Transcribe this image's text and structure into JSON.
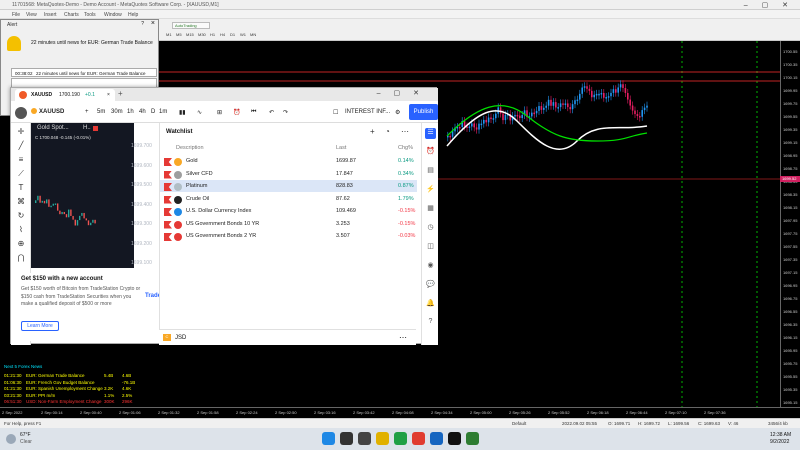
{
  "app": {
    "title": "11701568: MetaQuotes-Demo - Demo Account - MetaQuotes Software Corp. - [XAUUSD,M1]"
  },
  "menu": [
    "File",
    "View",
    "Insert",
    "Charts",
    "Tools",
    "Window",
    "Help"
  ],
  "toolbar": {
    "autotrading": "AutoTrading",
    "timeframes": [
      "M1",
      "M5",
      "M15",
      "M30",
      "H1",
      "H4",
      "D1",
      "W1",
      "MN"
    ]
  },
  "alert": {
    "title": "Alert",
    "help": "?",
    "message": "22 minutes until news for EUR: German Trade Balance",
    "time": "00:38:02",
    "list_message": "22 minutes until news for EUR: German Trade Balance"
  },
  "price_axis": [
    "1700.55",
    "1700.35",
    "1700.15",
    "1699.95",
    "1699.75",
    "1699.55",
    "1699.35",
    "1699.15",
    "1698.95",
    "1698.75",
    "1698.55",
    "1698.35",
    "1698.15",
    "1697.95",
    "1697.75",
    "1697.55",
    "1697.35",
    "1697.15",
    "1696.95",
    "1696.75",
    "1696.55",
    "1696.35",
    "1696.15",
    "1695.95",
    "1695.75",
    "1695.55",
    "1695.35",
    "1695.15"
  ],
  "price_marker": "1699.52",
  "time_axis": [
    "2 Sep 2022",
    "2 Sep 00:14",
    "2 Sep 00:40",
    "2 Sep 01:06",
    "2 Sep 01:32",
    "2 Sep 01:58",
    "2 Sep 02:24",
    "2 Sep 02:50",
    "2 Sep 03:16",
    "2 Sep 03:42",
    "2 Sep 04:08",
    "2 Sep 04:34",
    "2 Sep 05:00",
    "2 Sep 05:26",
    "2 Sep 05:52",
    "2 Sep 06:18",
    "2 Sep 06:44",
    "2 Sep 07:10",
    "2 Sep 07:36"
  ],
  "news": {
    "header": "Next 5 Forex News",
    "rows": [
      {
        "time": "01:21:30",
        "text": "EUR: German Trade Balance",
        "v1": "5.4B",
        "v2": "4.6B",
        "color": "#ffff00"
      },
      {
        "time": "01:06:30",
        "text": "EUR: French Gov Budget Balance",
        "v1": "",
        "v2": "-76.1B",
        "color": "#ffff00"
      },
      {
        "time": "01:21:30",
        "text": "EUR: Spanish Unemployment Change",
        "v1": "3.2K",
        "v2": "4.6K",
        "color": "#ffff00"
      },
      {
        "time": "03:21:30",
        "text": "EUR: PPI m/m",
        "v1": "1.1%",
        "v2": "2.5%",
        "color": "#ffff00"
      },
      {
        "time": "06:51:30",
        "text": "USD: Non-Farm Employment Change",
        "v1": "300K",
        "v2": "296K",
        "color": "#ff3333"
      }
    ]
  },
  "status": {
    "help": "For Help, press F1",
    "profile": "Default",
    "datetime": "2022.09.02 05:55",
    "open": "O: 1699.71",
    "high": "H: 1699.72",
    "low": "L: 1699.56",
    "close": "C: 1699.63",
    "volume": "V: 46",
    "traffic": "3456/4 kb"
  },
  "taskbar": {
    "weather_temp": "67°F",
    "weather_text": "Clear",
    "time": "12:38 AM",
    "date": "9/2/2022"
  },
  "tv": {
    "tab_title": "XAUUSD",
    "tab_price": "1700.190",
    "tab_change": "+0.1",
    "symbol": "XAUUSD",
    "intervals": [
      "5m",
      "30m",
      "1h",
      "4h",
      "D",
      "1m"
    ],
    "interest_label": "INTEREST INF...",
    "publish": "Publish",
    "mini_title": "Gold Spot...",
    "mini_tf": "H..",
    "mini_values": "C 1700.048 -0.145 (-0.01%)",
    "mini_axis": [
      "1699.700",
      "1699.600",
      "1699.500",
      "1699.400",
      "1699.300",
      "1699.200",
      "1699.100"
    ],
    "ad": {
      "title": "Get $150 with a new account",
      "text": "Get $150 worth of Bitcoin from TradeStation Crypto or $150 cash from TradeStation Securities when you make a qualified deposit of $500 or more",
      "button": "Learn More",
      "logo": "TradeStation",
      "close": "×"
    },
    "watchlist": {
      "title": "Watchlist",
      "col_desc": "Description",
      "col_last": "Last",
      "col_chg": "Chg%",
      "rows": [
        {
          "name": "Gold",
          "last": "1699.87",
          "chg": "0.14%",
          "pos": true,
          "color": "#f9a825",
          "selected": false
        },
        {
          "name": "Silver CFD",
          "last": "17.847",
          "chg": "0.34%",
          "pos": true,
          "color": "#9e9e9e",
          "selected": false
        },
        {
          "name": "Platinum",
          "last": "828.83",
          "chg": "0.87%",
          "pos": true,
          "color": "#b0bec5",
          "selected": true
        },
        {
          "name": "Crude Oil",
          "last": "87.62",
          "chg": "1.79%",
          "pos": true,
          "color": "#222222",
          "selected": false
        },
        {
          "name": "U.S. Dollar Currency Index",
          "last": "109.469",
          "chg": "-0.15%",
          "pos": false,
          "color": "#1e88e5",
          "selected": false
        },
        {
          "name": "US Government Bonds 10 YR",
          "last": "3.253",
          "chg": "-0.15%",
          "pos": false,
          "color": "#e53935",
          "selected": false
        },
        {
          "name": "US Government Bonds 2 YR",
          "last": "3.507",
          "chg": "-0.03%",
          "pos": false,
          "color": "#e53935",
          "selected": false
        }
      ],
      "bottom_symbol": "JSD",
      "bottom_badge": "C"
    }
  }
}
